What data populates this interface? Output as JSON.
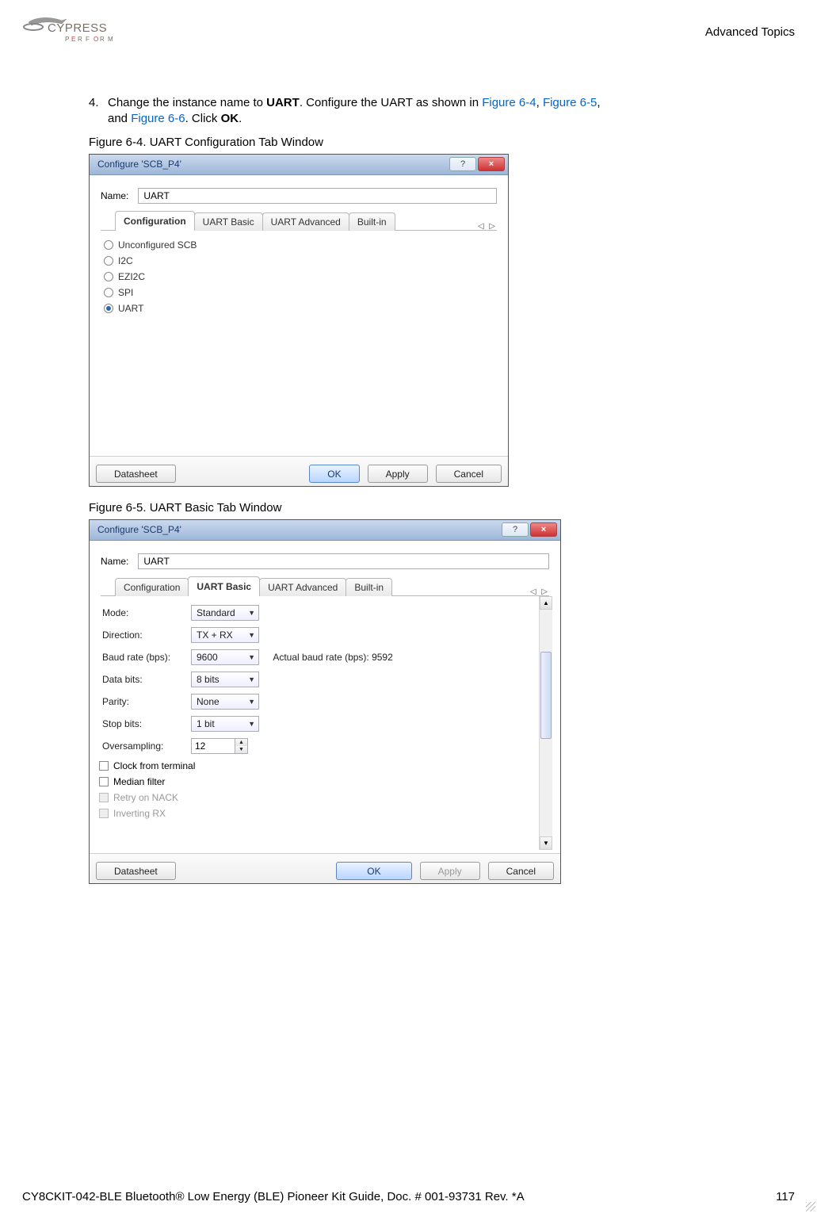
{
  "header": {
    "section": "Advanced Topics"
  },
  "step": {
    "num": "4.",
    "text_a": "Change the instance name to ",
    "bold_a": "UART",
    "text_b": ". Configure the UART as shown in ",
    "link1": "Figure 6-4",
    "comma1": ", ",
    "link2": "Figure 6-5",
    "comma2": ",",
    "text_c": "and ",
    "link3": "Figure 6-6",
    "text_d": ". Click ",
    "bold_b": "OK",
    "text_e": "."
  },
  "fig1_caption": "Figure 6-4.  UART Configuration Tab Window",
  "fig2_caption": "Figure 6-5.  UART Basic Tab Window",
  "dlg_common": {
    "title": "Configure 'SCB_P4'",
    "name_label": "Name:",
    "name_value": "UART",
    "tab_nav": "◁  ▷",
    "help_label": "?",
    "close_label": "×"
  },
  "dlg1": {
    "tabs": [
      "Configuration",
      "UART Basic",
      "UART Advanced",
      "Built-in"
    ],
    "active_tab": 0,
    "radios": [
      {
        "label": "Unconfigured SCB",
        "selected": false
      },
      {
        "label": "I2C",
        "selected": false
      },
      {
        "label": "EZI2C",
        "selected": false
      },
      {
        "label": "SPI",
        "selected": false
      },
      {
        "label": "UART",
        "selected": true
      }
    ],
    "buttons": {
      "datasheet": "Datasheet",
      "ok": "OK",
      "apply": "Apply",
      "cancel": "Cancel"
    }
  },
  "dlg2": {
    "tabs": [
      "Configuration",
      "UART Basic",
      "UART Advanced",
      "Built-in"
    ],
    "active_tab": 1,
    "fields": {
      "mode": {
        "label": "Mode:",
        "value": "Standard"
      },
      "direction": {
        "label": "Direction:",
        "value": "TX + RX"
      },
      "baud": {
        "label": "Baud rate (bps):",
        "value": "9600",
        "note": "Actual baud rate (bps): 9592"
      },
      "databits": {
        "label": "Data bits:",
        "value": "8 bits"
      },
      "parity": {
        "label": "Parity:",
        "value": "None"
      },
      "stopbits": {
        "label": "Stop bits:",
        "value": "1 bit"
      },
      "oversampling": {
        "label": "Oversampling:",
        "value": "12"
      }
    },
    "checks": [
      {
        "label": "Clock from terminal",
        "disabled": false
      },
      {
        "label": "Median filter",
        "disabled": false
      },
      {
        "label": "Retry on NACK",
        "disabled": true
      },
      {
        "label": "Inverting RX",
        "disabled": true
      }
    ],
    "buttons": {
      "datasheet": "Datasheet",
      "ok": "OK",
      "apply": "Apply",
      "cancel": "Cancel"
    }
  },
  "footer": {
    "left": "CY8CKIT-042-BLE Bluetooth® Low Energy (BLE) Pioneer Kit Guide, Doc. # 001-93731 Rev. *A",
    "right": "117"
  }
}
